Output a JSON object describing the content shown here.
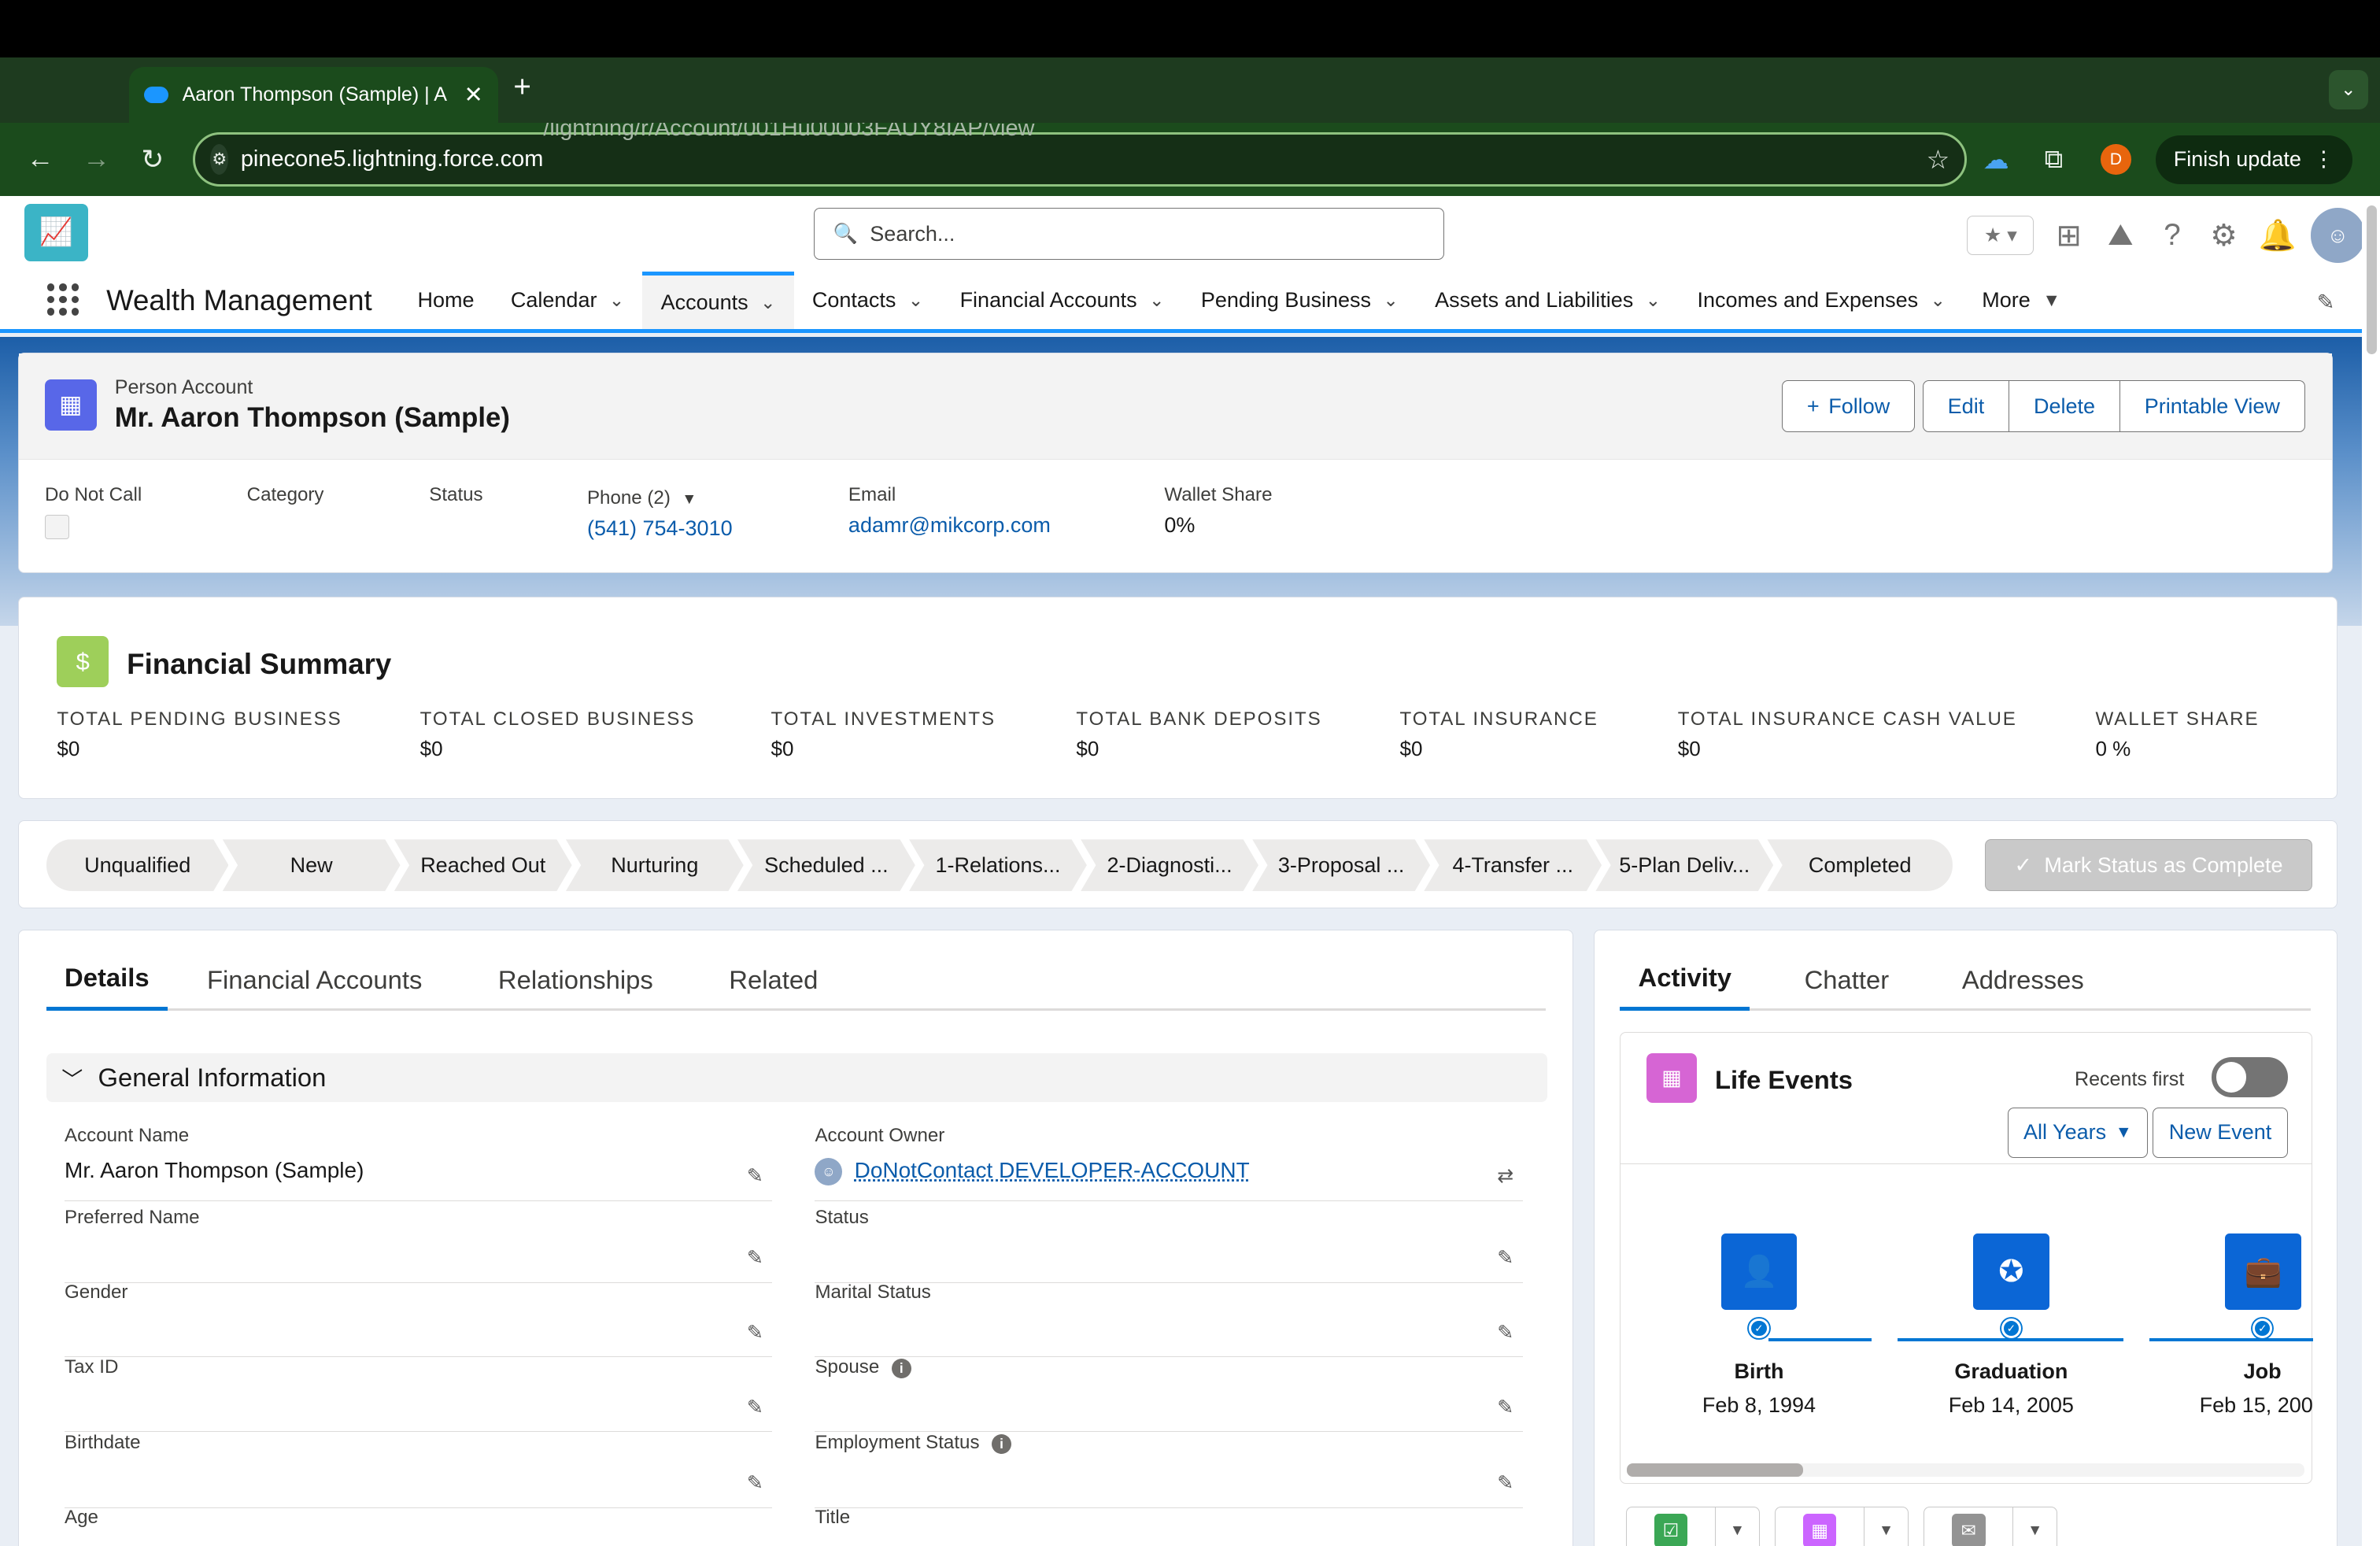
{
  "browser": {
    "tab_title": "Aaron Thompson (Sample) | A",
    "url_host": "pinecone5.lightning.force.com",
    "url_path": "/lightning/r/Account/001Hu00003FAUY8IAP/view",
    "profile_letter": "D",
    "finish_update": "Finish update"
  },
  "header": {
    "search_placeholder": "Search...",
    "app_name": "Wealth Management",
    "nav": [
      {
        "label": "Home",
        "dropdown": false
      },
      {
        "label": "Calendar",
        "dropdown": true
      },
      {
        "label": "Accounts",
        "dropdown": true,
        "active": true
      },
      {
        "label": "Contacts",
        "dropdown": true
      },
      {
        "label": "Financial Accounts",
        "dropdown": true
      },
      {
        "label": "Pending Business",
        "dropdown": true
      },
      {
        "label": "Assets and Liabilities",
        "dropdown": true
      },
      {
        "label": "Incomes and Expenses",
        "dropdown": true
      },
      {
        "label": "More",
        "dropdown": true
      }
    ]
  },
  "record": {
    "type": "Person Account",
    "name": "Mr. Aaron Thompson (Sample)",
    "buttons": {
      "follow": "Follow",
      "edit": "Edit",
      "delete": "Delete",
      "printable": "Printable View"
    },
    "highlights": {
      "do_not_call_label": "Do Not Call",
      "category_label": "Category",
      "status_label": "Status",
      "phone_label": "Phone (2)",
      "phone_value": "(541) 754-3010",
      "email_label": "Email",
      "email_value": "adamr@mikcorp.com",
      "wallet_label": "Wallet Share",
      "wallet_value": "0%"
    }
  },
  "financial_summary": {
    "title": "Financial Summary",
    "metrics": [
      {
        "label": "TOTAL PENDING BUSINESS",
        "value": "$0"
      },
      {
        "label": "TOTAL CLOSED BUSINESS",
        "value": "$0"
      },
      {
        "label": "TOTAL INVESTMENTS",
        "value": "$0"
      },
      {
        "label": "TOTAL BANK DEPOSITS",
        "value": "$0"
      },
      {
        "label": "TOTAL INSURANCE",
        "value": "$0"
      },
      {
        "label": "TOTAL INSURANCE CASH VALUE",
        "value": "$0"
      },
      {
        "label": "WALLET SHARE",
        "value": "0 %"
      }
    ]
  },
  "path": {
    "steps": [
      "Unqualified",
      "New",
      "Reached Out",
      "Nurturing",
      "Scheduled ...",
      "1-Relations...",
      "2-Diagnosti...",
      "3-Proposal ...",
      "4-Transfer ...",
      "5-Plan Deliv...",
      "Completed"
    ],
    "mark_complete": "Mark Status as Complete"
  },
  "details": {
    "tabs": [
      "Details",
      "Financial Accounts",
      "Relationships",
      "Related"
    ],
    "section": "General Information",
    "fields": [
      {
        "label": "Account Name",
        "value": "Mr. Aaron Thompson (Sample)"
      },
      {
        "label": "Account Owner",
        "value": "DoNotContact DEVELOPER-ACCOUNT"
      },
      {
        "label": "Preferred Name",
        "value": ""
      },
      {
        "label": "Status",
        "value": ""
      },
      {
        "label": "Gender",
        "value": ""
      },
      {
        "label": "Marital Status",
        "value": ""
      },
      {
        "label": "Tax ID",
        "value": ""
      },
      {
        "label": "Spouse",
        "value": ""
      },
      {
        "label": "Birthdate",
        "value": ""
      },
      {
        "label": "Employment Status",
        "value": ""
      },
      {
        "label": "Age",
        "value": ""
      },
      {
        "label": "Title",
        "value": ""
      }
    ]
  },
  "activity": {
    "tabs": [
      "Activity",
      "Chatter",
      "Addresses"
    ],
    "life_events_title": "Life Events",
    "recents_first": "Recents first",
    "all_years": "All Years",
    "new_event": "New Event",
    "events": [
      {
        "name": "Birth",
        "date": "Feb 8, 1994",
        "icon": "person-icon"
      },
      {
        "name": "Graduation",
        "date": "Feb 14, 2005",
        "icon": "award-icon"
      },
      {
        "name": "Job",
        "date": "Feb 15, 200",
        "icon": "briefcase-icon"
      }
    ]
  }
}
